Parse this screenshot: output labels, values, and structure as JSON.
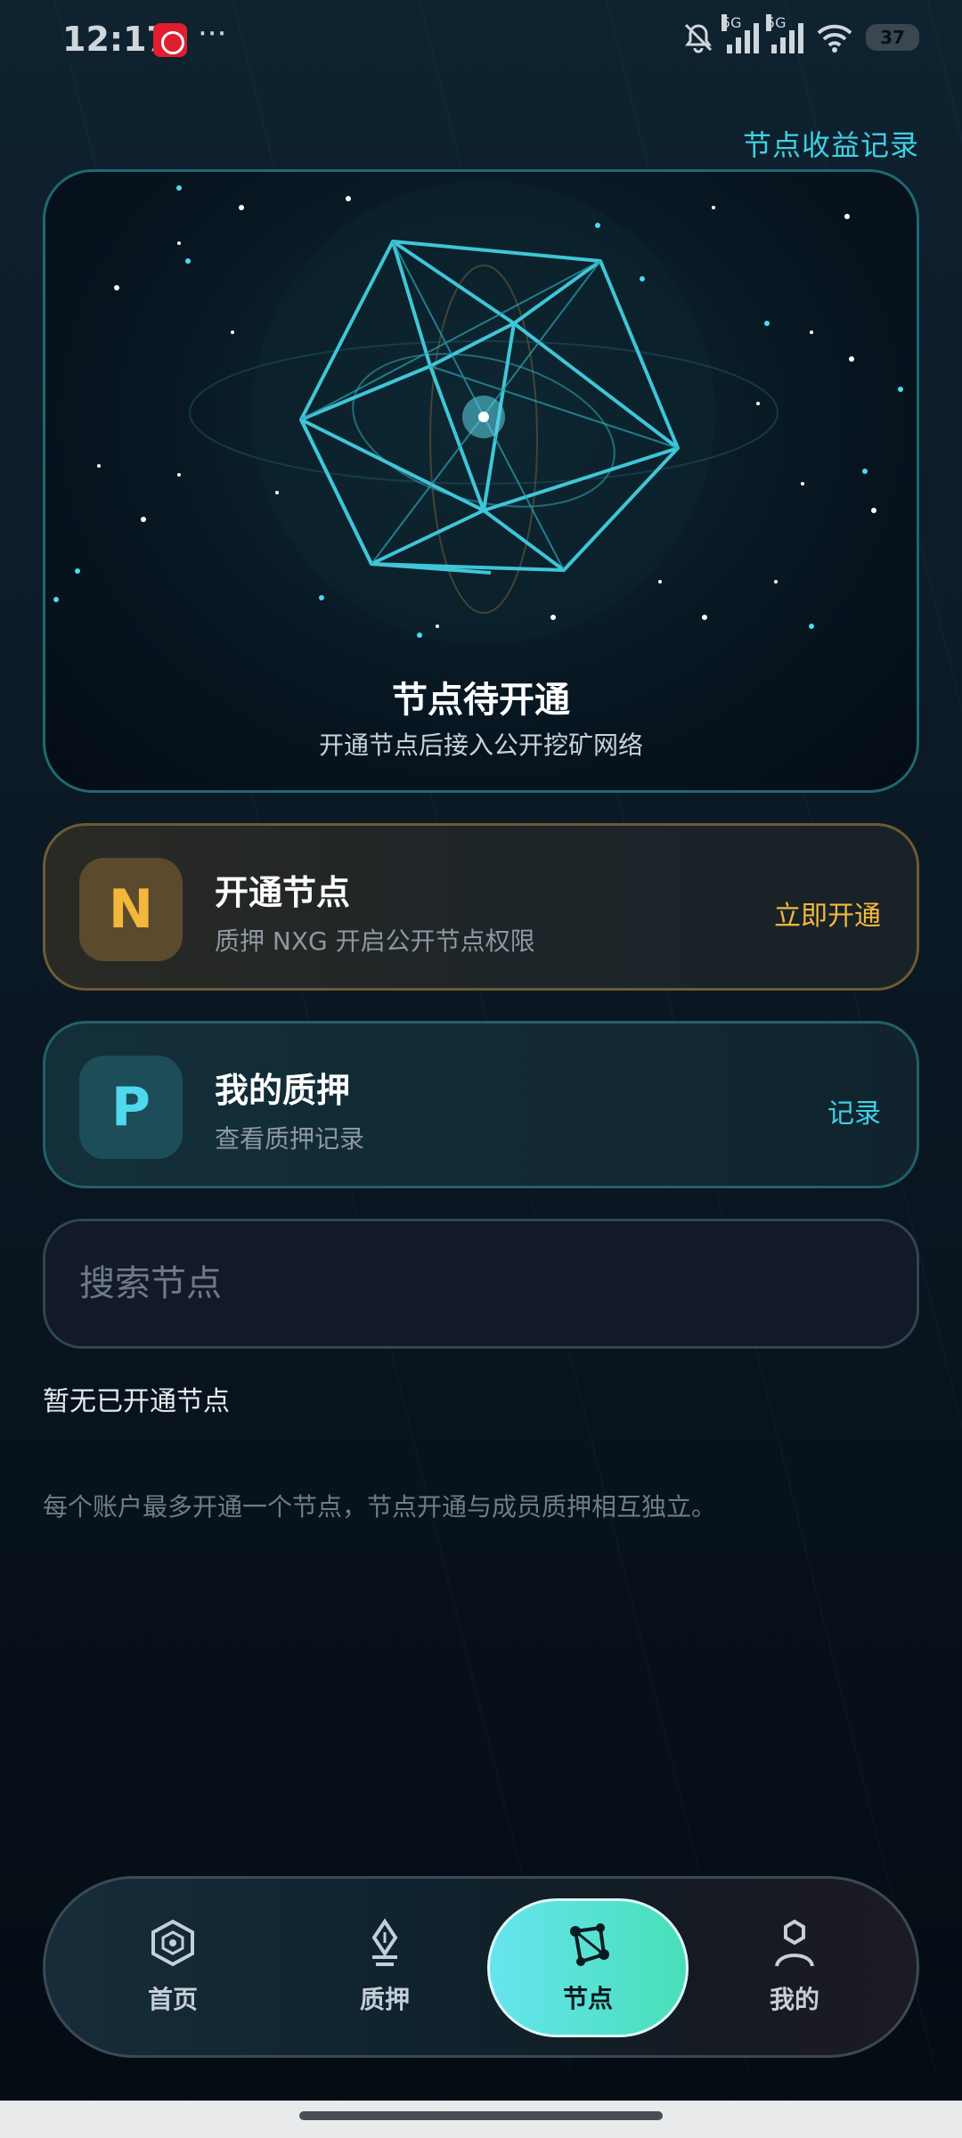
{
  "status_bar": {
    "time": "12:17",
    "dots": "···",
    "signal1_label": "5G",
    "signal2_label": "5G",
    "battery": "37"
  },
  "header": {
    "earnings_link": "节点收益记录"
  },
  "hero": {
    "title": "节点待开通",
    "subtitle": "开通节点后接入公开挖矿网络"
  },
  "open_node_card": {
    "icon_letter": "N",
    "title": "开通节点",
    "subtitle": "质押 NXG 开启公开节点权限",
    "action": "立即开通"
  },
  "pledge_card": {
    "icon_letter": "P",
    "title": "我的质押",
    "subtitle": "查看质押记录",
    "action": "记录"
  },
  "search": {
    "placeholder": "搜索节点"
  },
  "empty_state": "暂无已开通节点",
  "note": "每个账户最多开通一个节点，节点开通与成员质押相互独立。",
  "bottom_nav": {
    "items": [
      {
        "label": "首页",
        "icon": "home-hexagon-icon"
      },
      {
        "label": "质押",
        "icon": "pledge-pen-icon"
      },
      {
        "label": "节点",
        "icon": "node-network-icon",
        "active": true
      },
      {
        "label": "我的",
        "icon": "profile-user-icon"
      }
    ]
  },
  "colors": {
    "accent_cyan": "#3fd0e4",
    "accent_gold": "#f3b73c",
    "nav_active_start": "#66e4ee",
    "nav_active_end": "#48dfb8"
  }
}
